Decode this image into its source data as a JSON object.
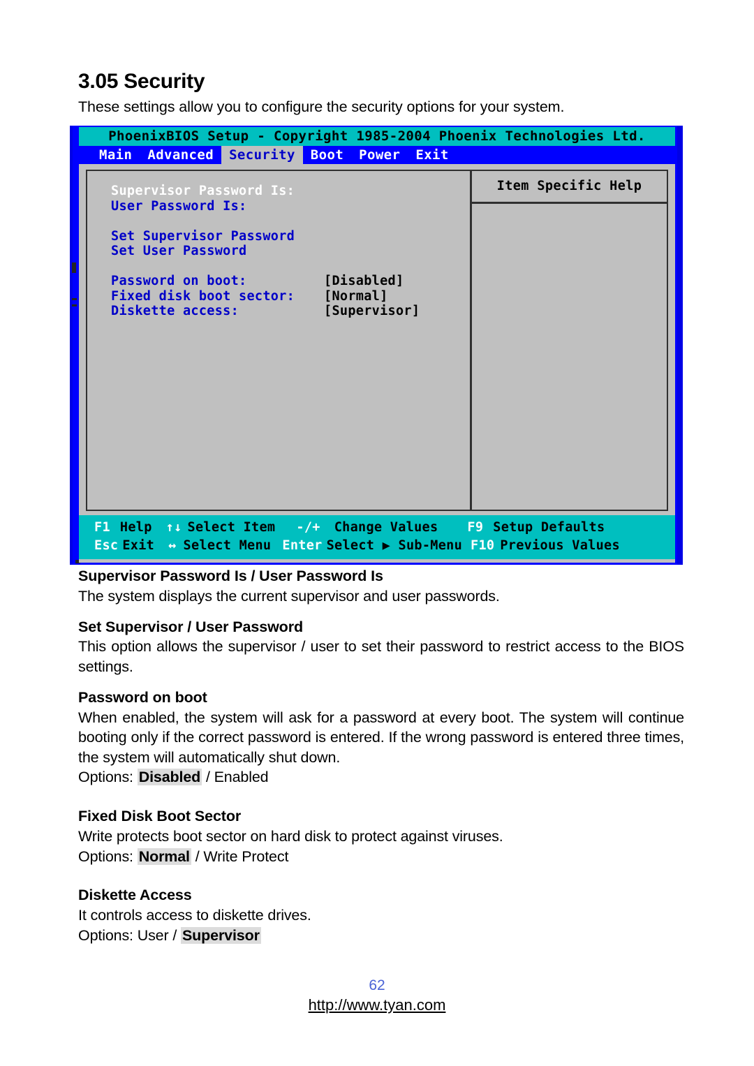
{
  "document": {
    "section_number_title": "3.05 Security",
    "intro": "These settings allow you to configure the security options for your system."
  },
  "bios": {
    "titlebar": "PhoenixBIOS Setup - Copyright 1985-2004 Phoenix Technologies Ltd.",
    "tabs": [
      {
        "label": "Main",
        "active": false
      },
      {
        "label": "Advanced",
        "active": false
      },
      {
        "label": "Security",
        "active": true
      },
      {
        "label": "Boot",
        "active": false
      },
      {
        "label": "Power",
        "active": false
      },
      {
        "label": "Exit",
        "active": false
      }
    ],
    "items": [
      {
        "label": "Supervisor Password Is:",
        "value": "",
        "selected": true
      },
      {
        "label": "User Password Is:",
        "value": "",
        "selected": false
      },
      {
        "label": "",
        "value": "",
        "selected": false
      },
      {
        "label": "Set Supervisor Password",
        "value": "",
        "selected": false
      },
      {
        "label": "Set User Password",
        "value": "",
        "selected": false
      },
      {
        "label": "",
        "value": "",
        "selected": false
      },
      {
        "label": "Password on boot:",
        "value": "[Disabled]",
        "selected": false
      },
      {
        "label": "Fixed disk boot sector:",
        "value": "[Normal]",
        "selected": false
      },
      {
        "label": "Diskette access:",
        "value": "[Supervisor]",
        "selected": false
      }
    ],
    "help_title": "Item Specific Help",
    "help_body": "",
    "function_keys": {
      "row1": [
        {
          "key": "F1",
          "desc": "Help"
        },
        {
          "key": "↑↓",
          "desc": "Select Item"
        },
        {
          "key": "-/+",
          "desc": "Change Values"
        },
        {
          "key": "F9",
          "desc": "Setup Defaults"
        }
      ],
      "row2": [
        {
          "key": "Esc",
          "desc": "Exit"
        },
        {
          "key": "↔",
          "desc": "Select Menu"
        },
        {
          "key": "Enter",
          "desc": "Select ▶ Sub-Menu"
        },
        {
          "key": "F10",
          "desc": "Previous Values"
        }
      ]
    },
    "colors": {
      "titlebar_bg": "#00bfbf",
      "menubar_bg": "#0000ff",
      "panel_bg": "#c0c0c0",
      "label_blue": "#0000c8",
      "selected_white": "#ffffff",
      "frame_blue": "#0000e6"
    }
  },
  "sections": [
    {
      "heading": "Supervisor Password Is / User Password Is",
      "paragraphs": [
        "The system displays the current supervisor and user passwords."
      ],
      "options_prefix": "",
      "options": []
    },
    {
      "heading": "Set Supervisor / User Password",
      "paragraphs": [
        "This option allows the supervisor / user to set their password to restrict access to the BIOS settings."
      ],
      "options_prefix": "",
      "options": []
    },
    {
      "heading": "Password on boot",
      "paragraphs": [
        "When enabled, the system will ask for a password at every boot. The system will continue booting only if the correct password is entered. If the wrong password is entered three times, the system will automatically shut down."
      ],
      "options_prefix": "Options:",
      "options": [
        {
          "text": "Disabled",
          "highlighted": true
        },
        {
          "text": "Enabled",
          "highlighted": false
        }
      ]
    },
    {
      "heading": "Fixed Disk Boot Sector",
      "paragraphs": [
        "Write protects boot sector on hard disk to protect against viruses."
      ],
      "options_prefix": "Options:",
      "options": [
        {
          "text": "Normal",
          "highlighted": true
        },
        {
          "text": "Write Protect",
          "highlighted": false
        }
      ]
    },
    {
      "heading": "Diskette Access",
      "paragraphs": [
        "It controls access to diskette drives."
      ],
      "options_prefix": "Options:",
      "options": [
        {
          "text": "User",
          "highlighted": false
        },
        {
          "text": "Supervisor",
          "highlighted": true
        }
      ]
    }
  ],
  "footer": {
    "page_number": "62",
    "url": "http://www.tyan.com",
    "page_number_color": "#4a62d6"
  }
}
